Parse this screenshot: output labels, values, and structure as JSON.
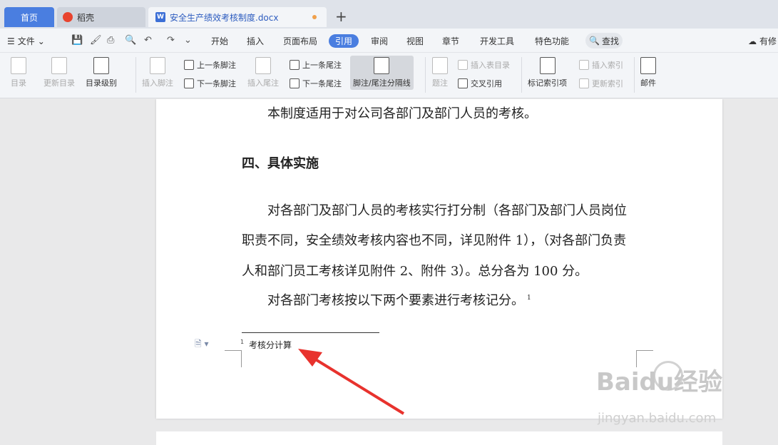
{
  "tabs": {
    "home": "首页",
    "daoke": "稻壳",
    "doc": "安全生产绩效考核制度.docx",
    "add": "+"
  },
  "menubar": {
    "file": "文件",
    "tabs": [
      "开始",
      "插入",
      "页面布局",
      "引用",
      "审阅",
      "视图",
      "章节",
      "开发工具",
      "特色功能"
    ],
    "active_tab": "引用",
    "search": "查找",
    "cloud": "有修"
  },
  "ribbon": {
    "toc": "目录",
    "update_toc": "更新目录",
    "toc_level": "目录级别",
    "insert_footnote": "插入脚注",
    "prev_footnote": "上一条脚注",
    "next_footnote": "下一条脚注",
    "insert_endnote": "插入尾注",
    "prev_endnote": "上一条尾注",
    "next_endnote": "下一条尾注",
    "separator": "脚注/尾注分隔线",
    "caption": "题注",
    "insert_figure_toc": "插入表目录",
    "cross_ref": "交叉引用",
    "mark_index": "标记索引项",
    "insert_index": "插入索引",
    "update_index": "更新索引",
    "mail": "邮件"
  },
  "document": {
    "line1": "本制度适用于对公司各部门及部门人员的考核。",
    "heading": "四、具体实施",
    "para1_l1": "对各部门及部门人员的考核实行打分制（各部门及部门人员岗位",
    "para1_l2": "职责不同，安全绩效考核内容也不同，详见附件 1），（对各部门负责",
    "para1_l3": "人和部门员工考核详见附件 2、附件 3）。总分各为 100 分。",
    "para2": "对各部门考核按以下两个要素进行考核记分。",
    "footnote_ref": "1",
    "footnote_num": "1",
    "footnote_text": "考核分计算"
  },
  "watermark": {
    "main": "Baidu经验",
    "sub": "jingyan.baidu.com"
  },
  "colors": {
    "accent": "#4a7ee0",
    "arrow": "#e8322d"
  }
}
